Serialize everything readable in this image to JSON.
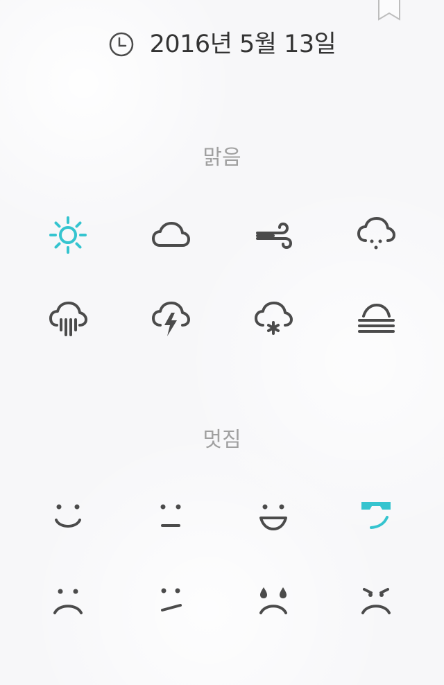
{
  "header": {
    "date_text": "2016년 5월 13일"
  },
  "sections": {
    "weather": {
      "title": "맑음",
      "items": [
        {
          "icon": "sun-icon",
          "selected": true
        },
        {
          "icon": "cloud-icon",
          "selected": false
        },
        {
          "icon": "wind-icon",
          "selected": false
        },
        {
          "icon": "drizzle-icon",
          "selected": false
        },
        {
          "icon": "rain-icon",
          "selected": false
        },
        {
          "icon": "thunderstorm-icon",
          "selected": false
        },
        {
          "icon": "snow-icon",
          "selected": false
        },
        {
          "icon": "fog-icon",
          "selected": false
        }
      ]
    },
    "mood": {
      "title": "멋짐",
      "items": [
        {
          "icon": "smile-icon",
          "selected": false
        },
        {
          "icon": "neutral-face-icon",
          "selected": false
        },
        {
          "icon": "grin-icon",
          "selected": false
        },
        {
          "icon": "cool-face-icon",
          "selected": true
        },
        {
          "icon": "sad-face-icon",
          "selected": false
        },
        {
          "icon": "skeptical-face-icon",
          "selected": false
        },
        {
          "icon": "crying-face-icon",
          "selected": false
        },
        {
          "icon": "angry-face-icon",
          "selected": false
        }
      ]
    }
  },
  "colors": {
    "accent": "#35c4cf",
    "icon": "#4b4b4b",
    "title": "#a0a0a0",
    "text": "#333333",
    "background": "#f7f7f9"
  }
}
